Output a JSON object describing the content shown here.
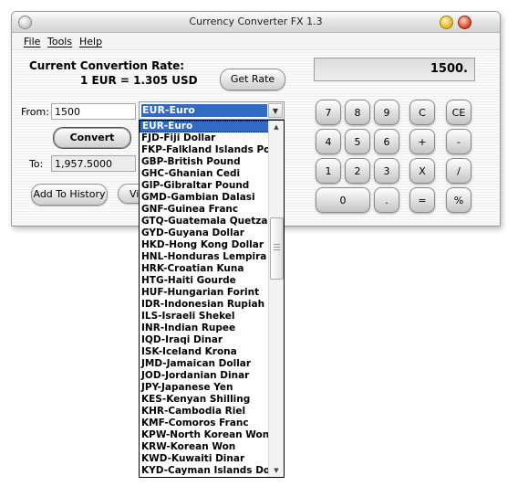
{
  "window": {
    "title": "Currency Converter FX 1.3"
  },
  "menu": [
    "File",
    "Tools",
    "Help"
  ],
  "rate": {
    "heading": "Current Convertion Rate:",
    "value": "1 EUR = 1.305 USD"
  },
  "buttons": {
    "get_rate": "Get Rate",
    "convert": "Convert",
    "add_history": "Add To History",
    "view": "Vi"
  },
  "from": {
    "label": "From:",
    "value": "1500",
    "currency": "EUR-Euro"
  },
  "to": {
    "label": "To:",
    "value": "1,957.5000"
  },
  "calculator": {
    "display": "1500.",
    "keys": [
      "7",
      "8",
      "9",
      "C",
      "CE",
      "4",
      "5",
      "6",
      "+",
      "-",
      "1",
      "2",
      "3",
      "X",
      "/",
      "0",
      ".",
      "=",
      "%"
    ]
  },
  "currency_list": [
    "EUR-Euro",
    "FJD-Fiji Dollar",
    "FKP-Falkland Islands Pou",
    "GBP-British Pound",
    "GHC-Ghanian Cedi",
    "GIP-Gibraltar Pound",
    "GMD-Gambian Dalasi",
    "GNF-Guinea Franc",
    "GTQ-Guatemala Quetzal",
    "GYD-Guyana Dollar",
    "HKD-Hong Kong Dollar",
    "HNL-Honduras Lempira",
    "HRK-Croatian Kuna",
    "HTG-Haiti Gourde",
    "HUF-Hungarian Forint",
    "IDR-Indonesian Rupiah",
    "ILS-Israeli Shekel",
    "INR-Indian Rupee",
    "IQD-Iraqi Dinar",
    "ISK-Iceland Krona",
    "JMD-Jamaican Dollar",
    "JOD-Jordanian Dinar",
    "JPY-Japanese Yen",
    "KES-Kenyan Shilling",
    "KHR-Cambodia Riel",
    "KMF-Comoros Franc",
    "KPW-North Korean Won",
    "KRW-Korean Won",
    "KWD-Kuwaiti Dinar",
    "KYD-Cayman Islands Doll"
  ]
}
